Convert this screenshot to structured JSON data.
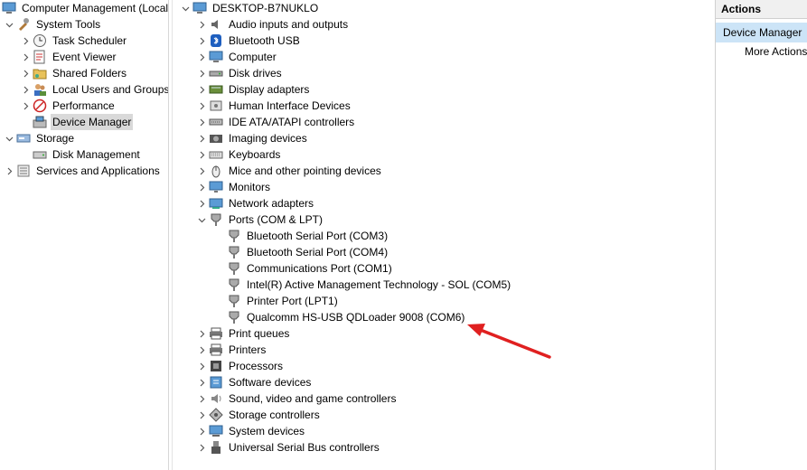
{
  "left": {
    "root": "Computer Management (Local",
    "system_tools": "System Tools",
    "task_scheduler": "Task Scheduler",
    "event_viewer": "Event Viewer",
    "shared_folders": "Shared Folders",
    "local_users": "Local Users and Groups",
    "performance": "Performance",
    "device_manager": "Device Manager",
    "storage": "Storage",
    "disk_management": "Disk Management",
    "services_apps": "Services and Applications"
  },
  "devices": {
    "root": "DESKTOP-B7NUKLO",
    "categories": [
      "Audio inputs and outputs",
      "Bluetooth USB",
      "Computer",
      "Disk drives",
      "Display adapters",
      "Human Interface Devices",
      "IDE ATA/ATAPI controllers",
      "Imaging devices",
      "Keyboards",
      "Mice and other pointing devices",
      "Monitors",
      "Network adapters",
      "Ports (COM & LPT)",
      "Print queues",
      "Printers",
      "Processors",
      "Software devices",
      "Sound, video and game controllers",
      "Storage controllers",
      "System devices",
      "Universal Serial Bus controllers"
    ],
    "ports": [
      "Bluetooth Serial Port (COM3)",
      "Bluetooth Serial Port (COM4)",
      "Communications Port (COM1)",
      "Intel(R) Active Management Technology - SOL (COM5)",
      "Printer Port (LPT1)",
      "Qualcomm HS-USB QDLoader 9008 (COM6)"
    ]
  },
  "actions": {
    "title": "Actions",
    "section": "Device Manager",
    "more": "More Actions"
  },
  "colors": {
    "arrow": "#e02020",
    "selection": "#cce4f7"
  }
}
